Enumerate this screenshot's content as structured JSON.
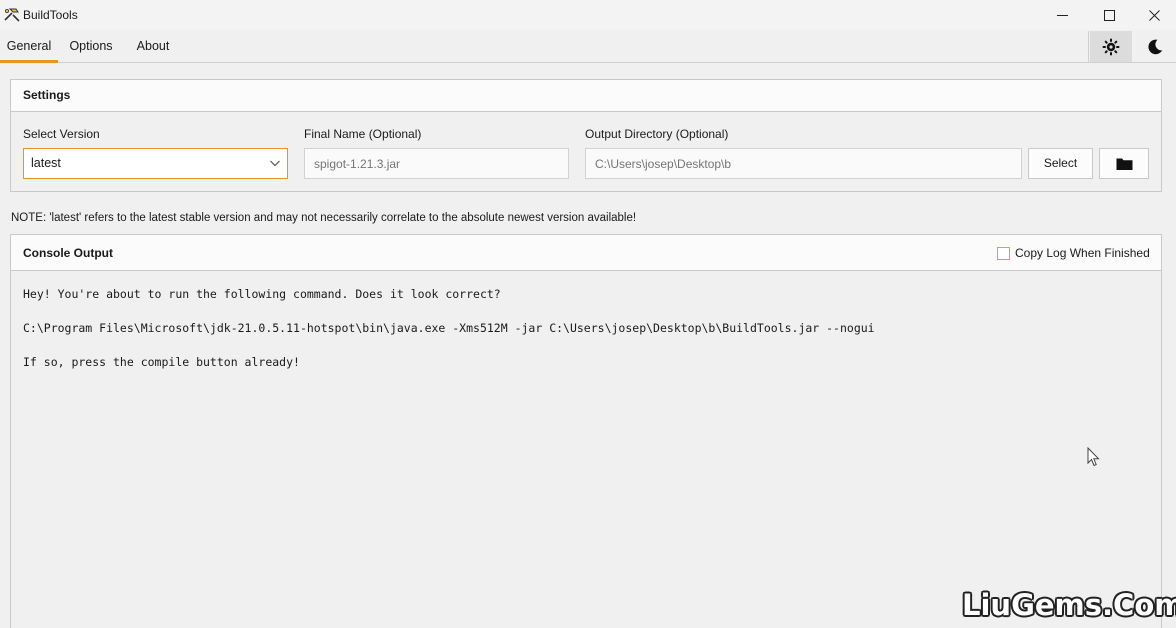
{
  "window": {
    "title": "BuildTools",
    "icon": "buildtools-hammer-icon",
    "controls": [
      "minimize-icon",
      "maximize-icon",
      "close-icon"
    ]
  },
  "tabs": [
    {
      "label": "General",
      "active": true
    },
    {
      "label": "Options",
      "active": false
    },
    {
      "label": "About",
      "active": false
    }
  ],
  "theme_toggle": {
    "light_icon": "sun-icon",
    "dark_icon": "moon-icon",
    "selected": "light"
  },
  "settings": {
    "title": "Settings",
    "version_label": "Select Version",
    "version_value": "latest",
    "final_name_label": "Final Name (Optional)",
    "final_name_placeholder": "spigot-1.21.3.jar",
    "output_label": "Output Directory (Optional)",
    "output_placeholder": "C:\\Users\\josep\\Desktop\\b",
    "select_button": "Select",
    "folder_icon": "folder-icon"
  },
  "note": "NOTE: 'latest' refers to the latest stable version and may not necessarily correlate to the absolute newest version available!",
  "console": {
    "title": "Console Output",
    "copy_log_label": "Copy Log When Finished",
    "copy_log_checked": false,
    "lines": [
      "Hey! You're about to run the following command. Does it look correct?",
      "C:\\Program Files\\Microsoft\\jdk-21.0.5.11-hotspot\\bin\\java.exe -Xms512M -jar C:\\Users\\josep\\Desktop\\b\\BuildTools.jar --nogui",
      "If so, press the compile button already!"
    ]
  },
  "watermark": "LiuGems.Com",
  "colors": {
    "accent": "#e8932a",
    "checkbox_border": "#d7a43e"
  }
}
